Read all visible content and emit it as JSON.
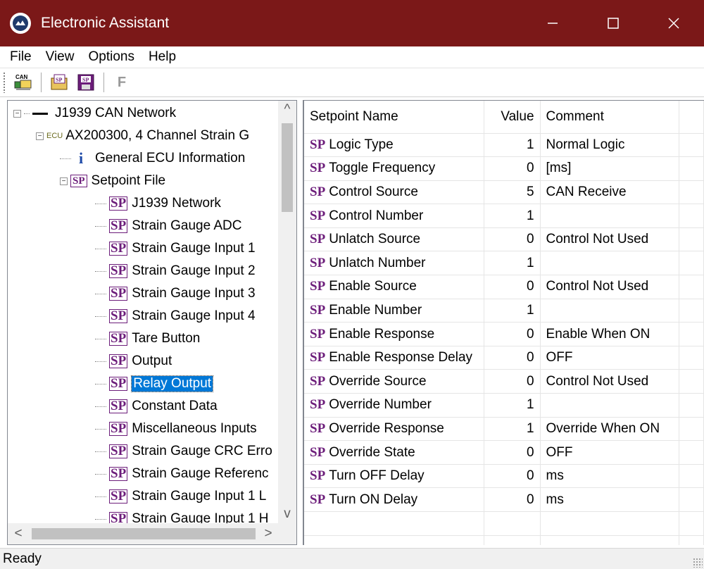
{
  "window": {
    "title": "Electronic Assistant",
    "titlebar_color": "#7b1818",
    "controls": [
      "minimize-icon",
      "maximize-icon",
      "close-icon"
    ]
  },
  "menu": [
    "File",
    "View",
    "Options",
    "Help"
  ],
  "toolbar": {
    "buttons": [
      {
        "name": "can-connect-icon",
        "label": "CAN"
      },
      {
        "name": "open-setpoint-file-icon",
        "label": "SP"
      },
      {
        "name": "save-setpoint-file-icon",
        "label": "SP"
      },
      {
        "name": "flash-icon",
        "label": "F",
        "enabled": false
      }
    ]
  },
  "tree": {
    "network": "J1939 CAN Network",
    "ecu_tag": "ECU",
    "ecu": "AX200300, 4 Channel Strain G",
    "general_info": "General ECU Information",
    "setpoint_file": "Setpoint File",
    "badge": "SP",
    "items": [
      "J1939 Network",
      "Strain Gauge ADC",
      "Strain Gauge Input 1",
      "Strain Gauge Input 2",
      "Strain Gauge Input 3",
      "Strain Gauge Input 4",
      "Tare Button",
      "Output",
      "Relay Output",
      "Constant Data",
      "Miscellaneous Inputs",
      "Strain Gauge CRC Erro",
      "Strain Gauge Referenc",
      "Strain Gauge Input 1 L",
      "Strain Gauge Input 1 H"
    ],
    "selected": "Relay Output"
  },
  "grid": {
    "headers": [
      "Setpoint Name",
      "Value",
      "Comment"
    ],
    "badge": "SP",
    "rows": [
      {
        "name": "Logic Type",
        "value": "1",
        "comment": "Normal Logic"
      },
      {
        "name": "Toggle Frequency",
        "value": "0",
        "comment": "[ms]"
      },
      {
        "name": "Control Source",
        "value": "5",
        "comment": "CAN Receive"
      },
      {
        "name": "Control Number",
        "value": "1",
        "comment": ""
      },
      {
        "name": "Unlatch Source",
        "value": "0",
        "comment": "Control Not Used"
      },
      {
        "name": "Unlatch Number",
        "value": "1",
        "comment": ""
      },
      {
        "name": "Enable Source",
        "value": "0",
        "comment": "Control Not Used"
      },
      {
        "name": "Enable Number",
        "value": "1",
        "comment": ""
      },
      {
        "name": "Enable Response",
        "value": "0",
        "comment": "Enable When ON"
      },
      {
        "name": "Enable Response Delay",
        "value": "0",
        "comment": "OFF"
      },
      {
        "name": "Override Source",
        "value": "0",
        "comment": "Control Not Used"
      },
      {
        "name": "Override Number",
        "value": "1",
        "comment": ""
      },
      {
        "name": "Override Response",
        "value": "1",
        "comment": "Override When ON"
      },
      {
        "name": "Override State",
        "value": "0",
        "comment": "OFF"
      },
      {
        "name": "Turn OFF Delay",
        "value": "0",
        "comment": "ms"
      },
      {
        "name": "Turn ON Delay",
        "value": "0",
        "comment": "ms"
      }
    ]
  },
  "status": {
    "text": "Ready"
  }
}
